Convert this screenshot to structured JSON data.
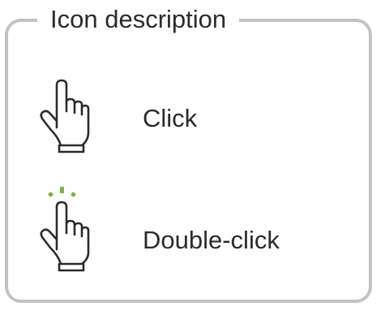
{
  "panel": {
    "title": "Icon description"
  },
  "rows": [
    {
      "label": "Click",
      "icon": "hand-pointer-icon"
    },
    {
      "label": "Double-click",
      "icon": "hand-double-click-icon"
    }
  ],
  "colors": {
    "border": "#c3c3c3",
    "text": "#2b2b2b",
    "accent": "#7cb342"
  }
}
